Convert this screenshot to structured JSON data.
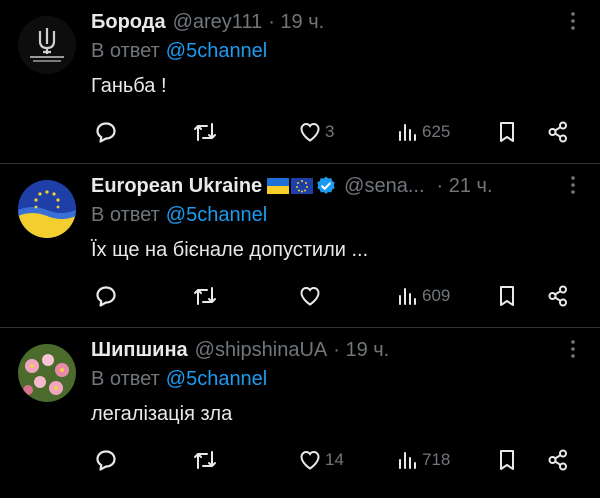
{
  "replies": [
    {
      "name": "Борода",
      "handle": "@arey111",
      "time": "· 19 ч.",
      "reply_prefix": "В ответ",
      "reply_to": "@5channel",
      "text": "Ганьба !",
      "likes": "3",
      "views": "625",
      "avatar": "trident-logo"
    },
    {
      "name": "European Ukraine",
      "handle": "@sena...",
      "time": "· 21 ч.",
      "reply_prefix": "В ответ",
      "reply_to": "@5channel",
      "text": "Їх ще на бієнале допустили ...",
      "likes": "",
      "views": "609",
      "avatar": "eu-ukraine-flag",
      "verified": true,
      "flags": [
        "ukraine-flag",
        "eu-flag"
      ]
    },
    {
      "name": "Шипшина",
      "handle": "@shipshinaUA",
      "time": "· 19 ч.",
      "reply_prefix": "В ответ",
      "reply_to": "@5channel",
      "text": "легалізація зла",
      "likes": "14",
      "views": "718",
      "avatar": "rosehip-flowers"
    }
  ],
  "colors": {
    "background": "#000000",
    "text": "#e7e9ea",
    "muted": "#71767b",
    "link": "#1d9bf0",
    "verified": "#1d9bf0",
    "divider": "#2f3336"
  },
  "icons": [
    "reply-icon",
    "repost-icon",
    "like-icon",
    "views-icon",
    "bookmark-icon",
    "share-icon",
    "more-icon",
    "verified-badge-icon"
  ]
}
